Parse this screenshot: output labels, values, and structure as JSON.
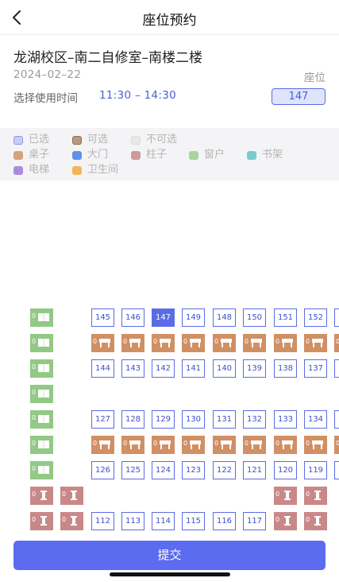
{
  "header": {
    "title": "座位预约",
    "back_icon": "chevron-left-icon"
  },
  "info": {
    "location": "龙湖校区–南二自修室–南楼二楼",
    "date": "2024–02–22",
    "seat_label": "座位",
    "time_label": "选择使用时间",
    "time_value": "11:30 – 14:30",
    "seat_value": "147"
  },
  "legend": {
    "selected": "已选",
    "available": "可选",
    "unavailable": "不可选",
    "desk": "桌子",
    "door": "大门",
    "pillar": "柱子",
    "window": "窗户",
    "shelf": "书架",
    "elevator": "电梯",
    "restroom": "卫生间"
  },
  "seat_map": {
    "object_prefix": "0",
    "row1": [
      "145",
      "146",
      "147",
      "149",
      "148",
      "150",
      "151",
      "152"
    ],
    "row3": [
      "144",
      "143",
      "142",
      "141",
      "140",
      "139",
      "138",
      "137"
    ],
    "row5": [
      "127",
      "128",
      "129",
      "130",
      "131",
      "132",
      "133",
      "134"
    ],
    "row7": [
      "126",
      "125",
      "124",
      "123",
      "122",
      "121",
      "120",
      "119"
    ],
    "row9": [
      "112",
      "113",
      "114",
      "115",
      "116",
      "117"
    ],
    "selected_seat": "147"
  },
  "footer": {
    "submit_label": "提交"
  },
  "colors": {
    "accent": "#5b6ce6",
    "desk": "#d18f64",
    "window": "#91c985",
    "pillar": "#c98888",
    "shelf": "#6ac7c9",
    "door": "#4a86e8",
    "elevator": "#a77cd6",
    "restroom": "#f2a93b"
  }
}
